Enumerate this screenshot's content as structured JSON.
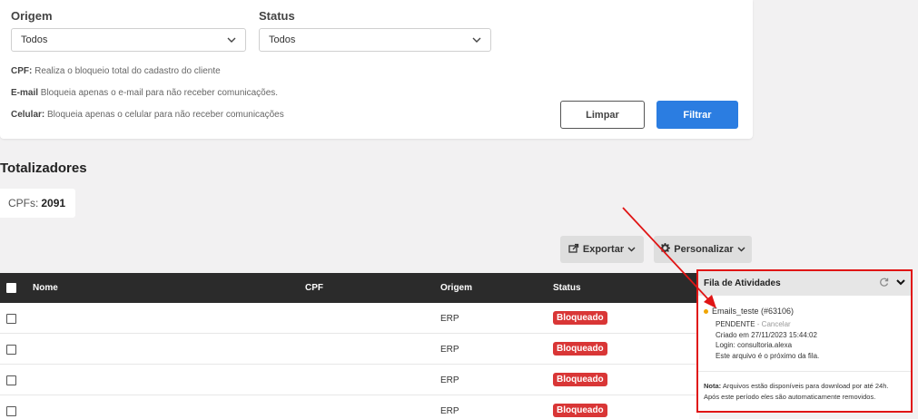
{
  "filters": {
    "origem_label": "Origem",
    "origem_value": "Todos",
    "status_label": "Status",
    "status_value": "Todos",
    "info": [
      {
        "term": "CPF:",
        "desc": " Realiza o bloqueio total do cadastro do cliente"
      },
      {
        "term": "E-mail",
        "desc": " Bloqueia apenas o e-mail para não receber comunicações."
      },
      {
        "term": "Celular:",
        "desc": " Bloqueia apenas o celular para não receber comunicações"
      }
    ],
    "clear_label": "Limpar",
    "filter_label": "Filtrar"
  },
  "totals": {
    "title": "Totalizadores",
    "cpfs_label": "CPFs:",
    "cpfs_value": "2091"
  },
  "toolbar": {
    "export_label": "Exportar",
    "customize_label": "Personalizar"
  },
  "table": {
    "columns": [
      "Nome",
      "CPF",
      "Origem",
      "Status"
    ],
    "rows": [
      {
        "origem": "ERP",
        "status": "Bloqueado"
      },
      {
        "origem": "ERP",
        "status": "Bloqueado"
      },
      {
        "origem": "ERP",
        "status": "Bloqueado"
      },
      {
        "origem": "ERP",
        "status": "Bloqueado"
      }
    ]
  },
  "activity": {
    "title": "Fila de Atividades",
    "job_name": "Emails_teste (#63106)",
    "job_status": "PENDENTE",
    "job_separator": " - ",
    "job_cancel": "Cancelar",
    "created": "Criado em 27/11/2023 15:44:02",
    "login": "Login: consultoria.alexa",
    "queue_note": "Este arquivo é o próximo da fila.",
    "note_label": "Nota:",
    "note_text": " Arquivos estão disponíveis para download por até 24h.",
    "note_text2": "Após este período eles são automaticamente removidos."
  },
  "colors": {
    "primary": "#2b7de1",
    "danger": "#d93636",
    "highlight": "#e01515",
    "pending": "#f0a500",
    "header_dark": "#2b2b2b"
  }
}
